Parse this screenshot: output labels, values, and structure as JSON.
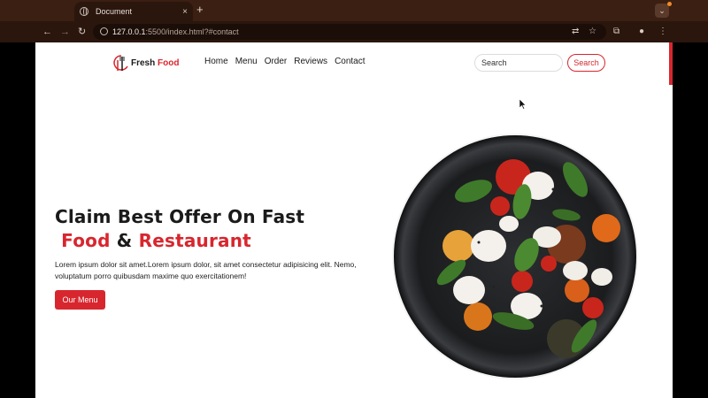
{
  "browser": {
    "tab_title": "Document",
    "tab_close": "×",
    "new_tab": "+",
    "url_host": "127.0.0.1",
    "url_path": ":5500/index.html?#contact",
    "tab_menu": "⌄"
  },
  "nav": {
    "logo_part1": "Fresh",
    "logo_part2": "Food",
    "menu": [
      "Home",
      "Menu",
      "Order",
      "Reviews",
      "Contact"
    ],
    "search_placeholder": "Search",
    "search_button": "Search"
  },
  "hero": {
    "title_line1": "Claim Best Offer On Fast",
    "title_word1": "Food",
    "title_amp": "&",
    "title_word2": "Restaurant",
    "text": "Lorem ipsum dolor sit amet.Lorem ipsum dolor, sit amet consectetur adipisicing elit. Nemo, voluptatum porro quibusdam maxime quo exercitationem!",
    "button": "Our Menu"
  },
  "colors": {
    "accent": "#d8262e",
    "text": "#1a1a1a",
    "chrome": "#2a160d"
  },
  "icons": [
    "globe-icon",
    "back-icon",
    "forward-icon",
    "reload-icon",
    "site-info-icon",
    "translate-icon",
    "star-icon",
    "extensions-icon",
    "menu-dots-icon"
  ]
}
